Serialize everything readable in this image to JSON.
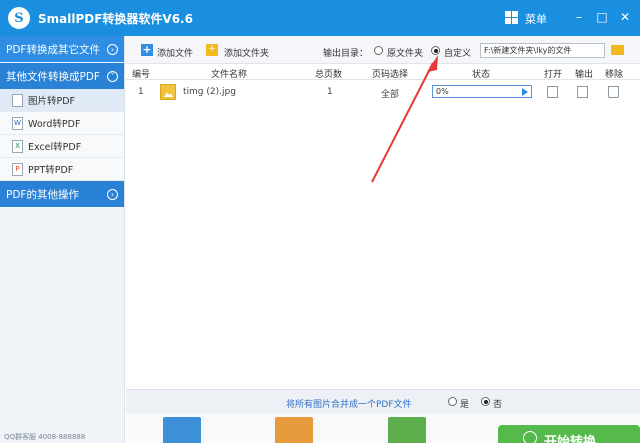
{
  "titlebar": {
    "logo_letter": "S",
    "title": "SmallPDF转换器软件V6.6",
    "menu_label": "菜单",
    "minimize": "–",
    "maximize": "□",
    "close": "✕"
  },
  "sidebar": {
    "group1": "PDF转换成其它文件",
    "group2": "其他文件转换成PDF",
    "items": [
      {
        "label": "图片转PDF",
        "active": true
      },
      {
        "label": "Word转PDF"
      },
      {
        "label": "Excel转PDF"
      },
      {
        "label": "PPT转PDF"
      }
    ],
    "group3": "PDF的其他操作",
    "footer": "QQ群客服  4008-888888"
  },
  "toolbar": {
    "add_file": "添加文件",
    "add_folder": "添加文件夹",
    "output_dir": "输出目录：",
    "original_folder": "原文件夹",
    "custom": "自定义",
    "path_value": "F:\\新建文件夹\\lky的文件"
  },
  "table": {
    "headers": [
      "编号",
      "文件名称",
      "总页数",
      "页码选择",
      "状态",
      "打开",
      "输出",
      "移除"
    ],
    "rows": [
      {
        "index": "1",
        "name": "timg (2).jpg",
        "pages": "1",
        "range": "全部",
        "progress": "0%",
        "progress_value": 0
      }
    ]
  },
  "merge": {
    "label": "将所有图片合并成一个PDF文件",
    "yes": "是",
    "no": "否"
  },
  "convert_button": "开始转换",
  "colors": {
    "accent": "#2f8de4",
    "arrow": "#e53935",
    "convert": "#56b94c"
  }
}
